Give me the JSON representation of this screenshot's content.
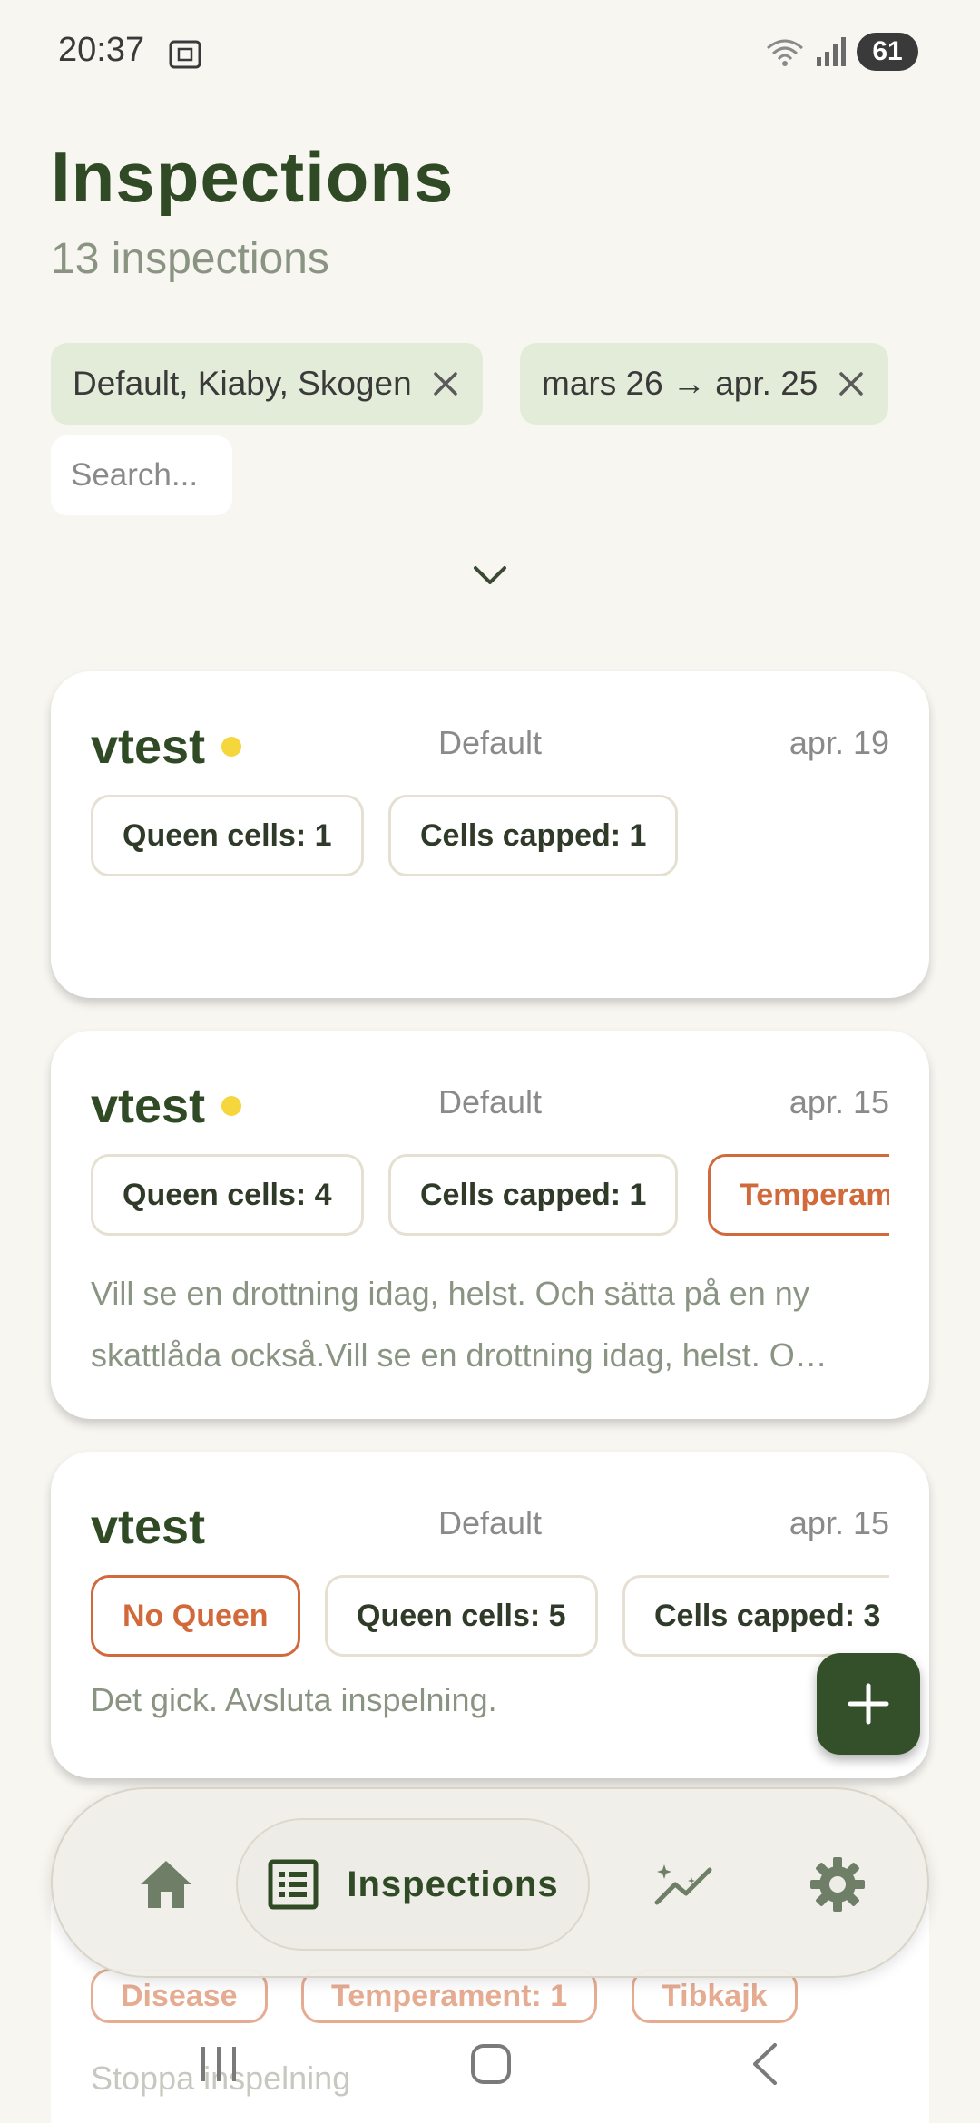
{
  "status": {
    "time": "20:37",
    "battery": "61",
    "icons": [
      "screenshot-icon",
      "wifi-icon",
      "signal-icon"
    ]
  },
  "header": {
    "title": "Inspections",
    "subtitle": "13 inspections"
  },
  "filters": {
    "chips": [
      {
        "label": "Default, Kiaby, Skogen"
      },
      {
        "label": "mars 26 → apr. 25"
      }
    ],
    "search_placeholder": "Search..."
  },
  "inspections": [
    {
      "name": "vtest",
      "has_dot": true,
      "apiary": "Default",
      "date": "apr. 19",
      "tags": [
        {
          "label": "Queen cells: 1",
          "warn": false
        },
        {
          "label": "Cells capped: 1",
          "warn": false
        }
      ],
      "notes": ""
    },
    {
      "name": "vtest",
      "has_dot": true,
      "apiary": "Default",
      "date": "apr. 15",
      "tags": [
        {
          "label": "Queen cells: 4",
          "warn": false
        },
        {
          "label": "Cells capped: 1",
          "warn": false
        },
        {
          "label": "Temperament",
          "warn": true
        }
      ],
      "notes": "Vill se en drottning idag, helst. Och sätta på en ny skattlåda också.Vill se en drottning idag, helst. O…"
    },
    {
      "name": "vtest",
      "has_dot": false,
      "apiary": "Default",
      "date": "apr. 15",
      "tags": [
        {
          "label": "No Queen",
          "warn": true
        },
        {
          "label": "Queen cells: 5",
          "warn": false
        },
        {
          "label": "Cells capped: 3",
          "warn": false
        }
      ],
      "notes": "Det gick. Avsluta inspelning."
    }
  ],
  "partial_card": {
    "tags": [
      "Disease",
      "Temperament: 1",
      "Tibkajk"
    ],
    "notes": "Stoppa inspelning"
  },
  "bottom_nav": {
    "items": [
      "home-icon",
      "inspections-icon",
      "insights-icon",
      "settings-icon"
    ],
    "active_label": "Inspections"
  },
  "colors": {
    "accent": "#2f4a24",
    "chip_bg": "#e3ecd9",
    "warn": "#d2693a",
    "dot": "#f5d63c",
    "background": "#f8f6f1"
  }
}
